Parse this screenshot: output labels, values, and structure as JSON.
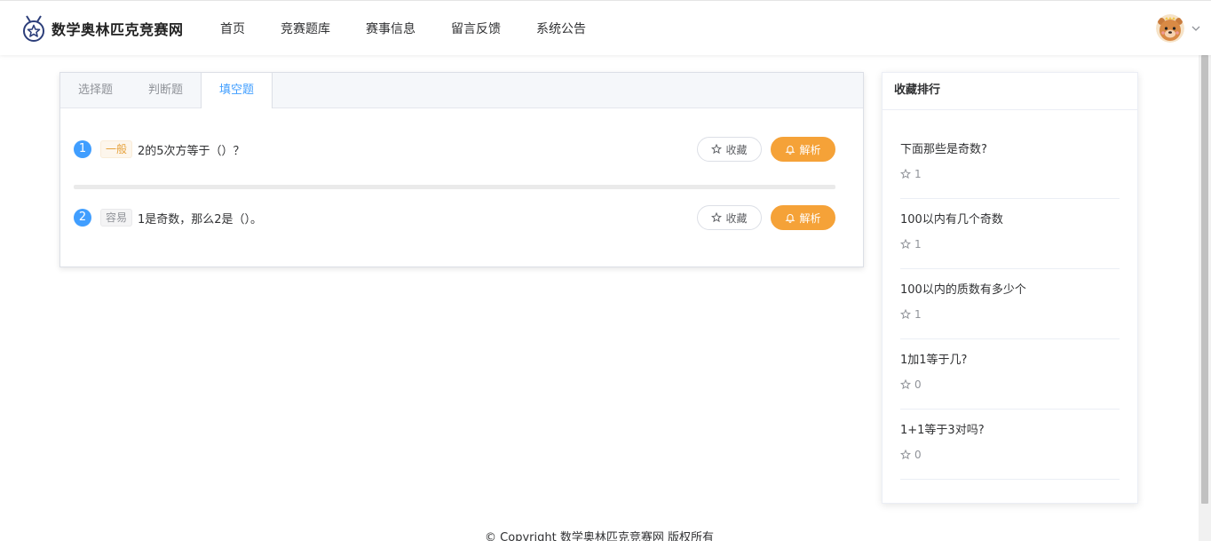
{
  "header": {
    "site_title": "数学奥林匹克竞赛网",
    "logo_icon": "medal-star-icon",
    "nav": [
      {
        "label": "首页"
      },
      {
        "label": "竞赛题库"
      },
      {
        "label": "赛事信息"
      },
      {
        "label": "留言反馈"
      },
      {
        "label": "系统公告"
      }
    ],
    "avatar_icon": "bear-avatar-icon",
    "dropdown_icon": "chevron-down-icon"
  },
  "tabs": [
    {
      "label": "选择题",
      "active": false
    },
    {
      "label": "判断题",
      "active": false
    },
    {
      "label": "填空题",
      "active": true
    }
  ],
  "questions": [
    {
      "number": "1",
      "difficulty": "一般",
      "text": "2的5次方等于（）？",
      "fav_label": "收藏",
      "analysis_label": "解析"
    },
    {
      "number": "2",
      "difficulty": "容易",
      "text": "1是奇数，那么2是（）。",
      "fav_label": "收藏",
      "analysis_label": "解析"
    }
  ],
  "ranking": {
    "title": "收藏排行",
    "items": [
      {
        "title": "下面那些是奇数?",
        "count": "1"
      },
      {
        "title": "100以内有几个奇数",
        "count": "1"
      },
      {
        "title": "100以内的质数有多少个",
        "count": "1"
      },
      {
        "title": "1加1等于几?",
        "count": "0"
      },
      {
        "title": "1+1等于3对吗?",
        "count": "0"
      }
    ]
  },
  "footer": {
    "text": "© Copyright 数学奥林匹克竞赛网 版权所有"
  },
  "colors": {
    "primary": "#409eff",
    "accent": "#f5a238",
    "tag_general": "#e6a23c",
    "tag_easy": "#909399"
  }
}
